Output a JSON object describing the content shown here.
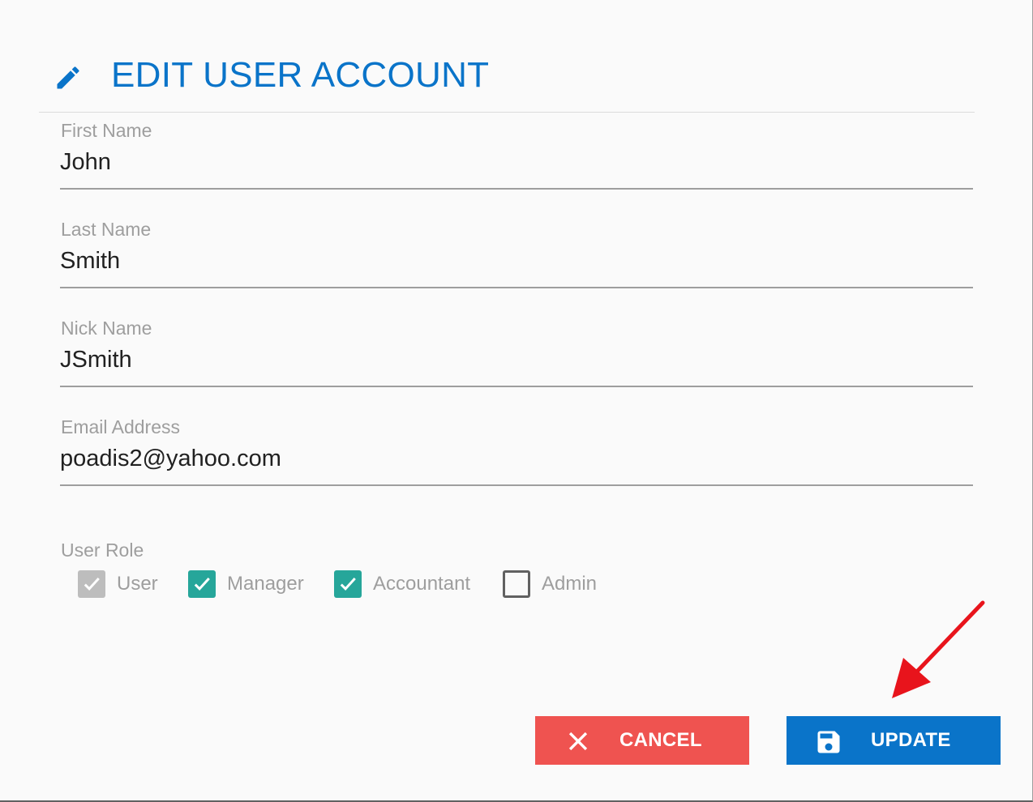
{
  "dialog": {
    "title": "EDIT USER ACCOUNT",
    "title_icon": "pencil-icon",
    "accent_color": "#0a74c9"
  },
  "fields": {
    "first_name": {
      "label": "First Name",
      "value": "John"
    },
    "last_name": {
      "label": "Last Name",
      "value": "Smith"
    },
    "nick_name": {
      "label": "Nick Name",
      "value": "JSmith"
    },
    "email": {
      "label": "Email Address",
      "value": "poadis2@yahoo.com"
    }
  },
  "user_role": {
    "label": "User Role",
    "options": [
      {
        "label": "User",
        "checked": true,
        "disabled": true
      },
      {
        "label": "Manager",
        "checked": true,
        "disabled": false
      },
      {
        "label": "Accountant",
        "checked": true,
        "disabled": false
      },
      {
        "label": "Admin",
        "checked": false,
        "disabled": false
      }
    ]
  },
  "buttons": {
    "cancel": {
      "label": "CANCEL",
      "icon": "close-icon",
      "color": "#ef5350"
    },
    "update": {
      "label": "UPDATE",
      "icon": "save-icon",
      "color": "#0a74c9"
    }
  },
  "annotation": {
    "icon": "red-arrow-icon",
    "color": "#e8141c"
  }
}
